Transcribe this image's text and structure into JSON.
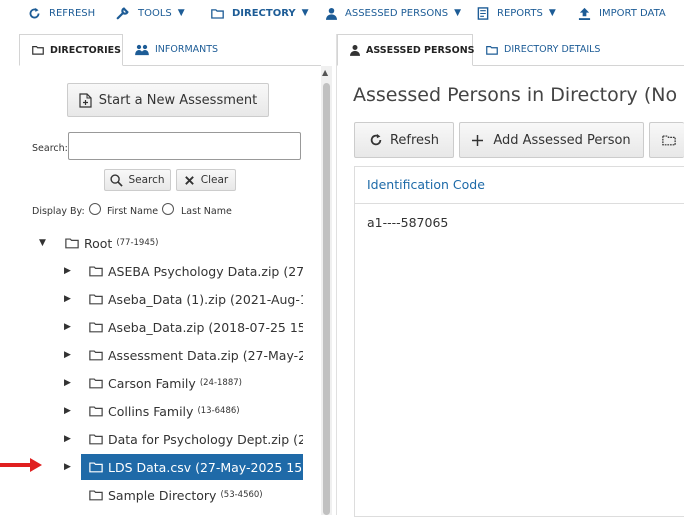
{
  "menu": {
    "refresh": "REFRESH",
    "tools": "TOOLS",
    "directory": "DIRECTORY",
    "assessed_persons": "ASSESSED PERSONS",
    "reports": "REPORTS",
    "import_data": "IMPORT DATA"
  },
  "left_tabs": {
    "directories": "DIRECTORIES",
    "informants": "INFORMANTS"
  },
  "start_button": "Start a New Assessment",
  "search": {
    "label": "Search:",
    "value": "",
    "search_button": "Search",
    "clear_button": "Clear"
  },
  "display_by": {
    "label": "Display By:",
    "first_name": "First Name",
    "last_name": "Last Name"
  },
  "tree": {
    "root": {
      "name": "Root",
      "count": "(77-1945)"
    },
    "items": [
      {
        "name": "ASEBA Psychology Data.zip (27-",
        "count": ""
      },
      {
        "name": "Aseba_Data (1).zip (2021-Aug-1",
        "count": ""
      },
      {
        "name": "Aseba_Data.zip (2018-07-25 15",
        "count": ""
      },
      {
        "name": "Assessment Data.zip (27-May-2",
        "count": ""
      },
      {
        "name": "Carson Family",
        "count": "(24-1887)"
      },
      {
        "name": "Collins Family",
        "count": "(13-6486)"
      },
      {
        "name": "Data for Psychology Dept.zip (2",
        "count": ""
      },
      {
        "name": "LDS Data.csv (27-May-2025 15:",
        "count": ""
      },
      {
        "name": "Sample Directory",
        "count": "(53-4560)"
      }
    ]
  },
  "right_tabs": {
    "assessed_persons": "ASSESSED PERSONS",
    "directory_details": "DIRECTORY DETAILS"
  },
  "main": {
    "title": "Assessed Persons in Directory (No S",
    "refresh_button": "Refresh",
    "add_button": "Add Assessed Person",
    "column_header": "Identification Code",
    "rows": [
      "a1----587065"
    ]
  },
  "colors": {
    "accent": "#1d5c96",
    "selected": "#1f6aa8",
    "arrow": "#e02020"
  }
}
